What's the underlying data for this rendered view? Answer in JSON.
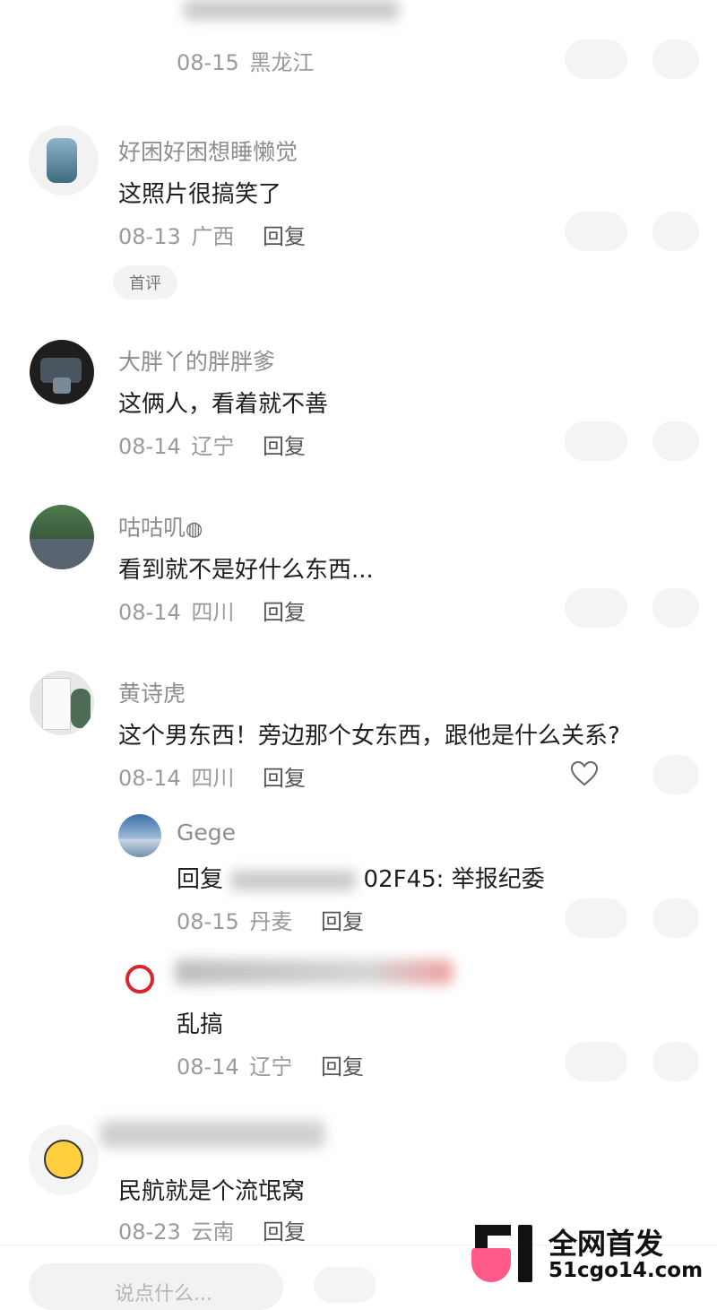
{
  "comments": [
    {
      "meta": {
        "date": "08-15",
        "location": "黑龙江"
      }
    },
    {
      "name": "好困好困想睡懒觉",
      "text": "这照片很搞笑了",
      "meta": {
        "date": "08-13",
        "location": "广西",
        "reply": "回复"
      },
      "badge": "首评"
    },
    {
      "name": "大胖丫的胖胖爹",
      "text": "这俩人，看着就不善",
      "meta": {
        "date": "08-14",
        "location": "辽宁",
        "reply": "回复"
      }
    },
    {
      "name": "咕咕叽",
      "text": "看到就不是好什么东西...",
      "meta": {
        "date": "08-14",
        "location": "四川",
        "reply": "回复"
      }
    },
    {
      "name": "黄诗虎",
      "text": "这个男东西！旁边那个女东西，跟他是什么关系?",
      "meta": {
        "date": "08-14",
        "location": "四川",
        "reply": "回复"
      }
    },
    {
      "name": "Gege",
      "reply_prefix": "回复",
      "reply_suffix": "02F45: 举报纪委",
      "meta": {
        "date": "08-15",
        "location": "丹麦",
        "reply": "回复"
      }
    },
    {
      "text": "乱搞",
      "meta": {
        "date": "08-14",
        "location": "辽宁",
        "reply": "回复"
      }
    },
    {
      "text": "民航就是个流氓窝",
      "meta": {
        "date": "08-23",
        "location": "云南",
        "reply": "回复"
      }
    }
  ],
  "icons": {
    "like": "heart-icon"
  },
  "watermark": {
    "title": "全网首发",
    "url": "51cgo14.com"
  },
  "input": {
    "placeholder": "说点什么..."
  },
  "colors": {
    "text": "#1e1e1e",
    "meta": "#9a9a9a",
    "watermark_pink": "#ff5a8a"
  }
}
